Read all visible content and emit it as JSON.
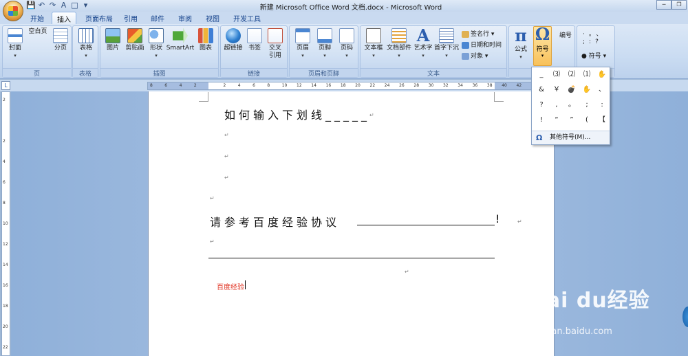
{
  "window": {
    "title": "新建 Microsoft Office Word 文档.docx - Microsoft Word",
    "min": "─",
    "restore": "❐"
  },
  "qat": [
    "💾",
    "↶",
    "↷",
    "A",
    "□",
    "▾"
  ],
  "tabs": [
    "开始",
    "插入",
    "页面布局",
    "引用",
    "邮件",
    "审阅",
    "视图",
    "开发工具"
  ],
  "active_tab": "插入",
  "groups": {
    "page": {
      "label": "页",
      "buttons": [
        "封面",
        "空白页",
        "分页"
      ]
    },
    "table": {
      "label": "表格",
      "buttons": [
        "表格"
      ]
    },
    "illus": {
      "label": "插图",
      "buttons": [
        "图片",
        "剪贴画",
        "形状",
        "SmartArt",
        "图表"
      ]
    },
    "links": {
      "label": "链接",
      "buttons": [
        "超链接",
        "书签",
        "交叉引用"
      ]
    },
    "hf": {
      "label": "页眉和页脚",
      "buttons": [
        "页眉",
        "页脚",
        "页码"
      ]
    },
    "text": {
      "label": "文本",
      "buttons": [
        "文本框",
        "文档部件",
        "艺术字",
        "首字下沉"
      ],
      "small": [
        "签名行",
        "日期和时间",
        "对象"
      ]
    },
    "special": {
      "buttons": [
        "公式",
        "符号",
        "编号"
      ]
    },
    "special2": {
      "small": "符号",
      "glyphs": [
        "·",
        "。",
        "、",
        ";",
        ":",
        "?"
      ]
    }
  },
  "ruler": {
    "h_ticks": [
      "8",
      "6",
      "4",
      "2",
      "",
      "2",
      "4",
      "6",
      "8",
      "10",
      "12",
      "14",
      "16",
      "18",
      "20",
      "22",
      "24",
      "26",
      "28",
      "30",
      "32",
      "34",
      "36",
      "38",
      "40",
      "42",
      "44"
    ],
    "v_ticks": [
      "2",
      "",
      "2",
      "4",
      "6",
      "8",
      "10",
      "12",
      "14",
      "16",
      "18",
      "20",
      "22"
    ]
  },
  "document": {
    "line1": "如何输入下划线_____",
    "line2": "请参考百度经验协议",
    "excl": "!",
    "red_text": "百度经验",
    "para_mark": "↵"
  },
  "symbol_menu": {
    "symbols": [
      "_",
      "⑶",
      "⑵",
      "⑴",
      "✋",
      "&",
      "￥",
      "💣",
      "✋",
      "、",
      "?",
      ",",
      "。",
      ";",
      ":",
      "!",
      "“",
      "”",
      "(",
      "【"
    ],
    "more": "其他符号(M)...",
    "more_icon": "Ω"
  },
  "watermark": {
    "text": "Bai du经验",
    "url": "jingyan.baidu.com"
  }
}
